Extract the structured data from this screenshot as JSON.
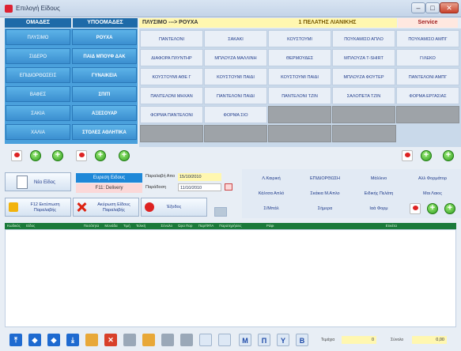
{
  "window": {
    "title": "Επιλογή Είδους",
    "min_label": "–",
    "max_label": "□",
    "close_label": "✕"
  },
  "header": {
    "groups_label": "ΟΜΑΔΕΣ",
    "subgroups_label": "ΥΠΟΟΜΑΔΕΣ",
    "path": "ΠΛΥΣΙΜΟ ---> ΡΟΥΧΑ",
    "customer": "1 ΠΕΛΑΤΗΣ ΛΙΑΝΙΚΗΣ",
    "user": "Service"
  },
  "groups": [
    "ΠΛΥΣΙΜΟ",
    "ΣΙΔΕΡΟ",
    "ΕΠΙΔΙΟΡΘΩΣΕΙΣ",
    "ΒΑΦΕΣ",
    "ΣΑΚΙΑ",
    "ΧΑΛΙΑ"
  ],
  "subgroups": [
    "ΡΟΥΧΑ",
    "ΠΑΙΔ ΜΠΟΥΦ ΔΑΚ",
    "ΓΥΝΑΙΚΕΙΑ",
    "ΣΠΙΤΙ",
    "ΑΞΕΣΟΥΑΡ",
    "ΣΤΟΛΕΣ ΑΘΛΗΤΙΚΑ"
  ],
  "items": [
    [
      "ΠΑΝΤΕΛΟΝΙ",
      "ΣΑΚΑΚΙ",
      "ΚΟΥΣΤΟΥΜΙ",
      "ΠΟΥΚΑΜΙΣΟ ΑΠΛΟ",
      "ΠΟΥΚΑΜΙΣΟ ΑΜΠΓ"
    ],
    [
      "ΔΙΑΦΟΡΑ ΠΛΥΝΤΗΡ",
      "ΜΠΛΟΥΖΑ ΜΑΛΛΙΝΗ",
      "ΘΕΡΜΟΥΔΕΣ",
      "ΜΠΛΟΥΖΑ Τ-SHIRT",
      "ΓΙΛΕΚΟ"
    ],
    [
      "ΚΟΥΣΤΟΥΜΙ ΑΘΕ Γ",
      "ΚΟΥΣΤΟΥΜΙ ΠΑΙΔΙ",
      "ΚΟΥΣΤΟΥΜΙ ΠΑΙΔΙ",
      "ΜΠΛΟΥΖΑ ΦΟΥΤΕΡ",
      "ΠΑΝΤΕΛΟΝΙ ΑΜΠΓ"
    ],
    [
      "ΠΑΝΤΕΛΟΝΙ ΜΗΧΑΝ",
      "ΠΑΝΤΕΛΟΝΙ ΠΑΙΔΙ",
      "ΠΑΝΤΕΛΟΝΙ ΤΖΙΝ",
      "ΣΑΛΟΠΕΤΑ ΤΖΙΝ",
      "ΦΟΡΜΑ ΕΡΓΑΣΙΑΣ"
    ],
    [
      "ΦΟΡΜΑ ΠΑΝΤΕΛΟΝΙ",
      "ΦΟΡΜΑ ΣΙΟ",
      "",
      "",
      ""
    ]
  ],
  "new_item": "Νέο Είδος",
  "tabs": {
    "active": "Ευρεση Ειδους",
    "idle": "F11: Delivery"
  },
  "dates": {
    "receive_label": "Παραλαβή Απο",
    "receive_value": "15/10/2010",
    "delivery_label": "Παράδοση",
    "delivery_value": "11/10/2010"
  },
  "actions": {
    "print": "F12 Εκτύπωση Παραλαβής",
    "cancel": "Ακύρωση Είδους Παραλαβής",
    "exit": "Έξοδος"
  },
  "pricing": [
    [
      "Λ.Καιρική",
      "ΕΠΙΔΙΟΡΘΩΣΗ",
      "Μάλλινο",
      "Αλλ Φορμάτορ"
    ],
    [
      "Κάλτσα Απλό",
      "Σκάκια Μ.Απλο",
      "Ειδικής Πελάτη",
      "Μαι Λαιος"
    ],
    [
      "Σ/Μπάλ",
      "Σήμερα",
      "Ιαά Φορμ",
      ""
    ]
  ],
  "table_headers": [
    "Κωδικός",
    "Είδος",
    "Ποσότητα",
    "Μονάδα",
    "Τιμή",
    "Τελική",
    "Σύνολο",
    "Ώρα Παρ",
    "Παρ/ΦΠΑ",
    "Παρατηρήσεις",
    "Ράφι",
    "Ετικέτα"
  ],
  "toolbar_letters": [
    "M",
    "Π",
    "Y",
    "B"
  ],
  "totals": {
    "label1": "Τεμάχια",
    "value1": "0",
    "label2": "Σύνολο",
    "value2": "0,00"
  }
}
